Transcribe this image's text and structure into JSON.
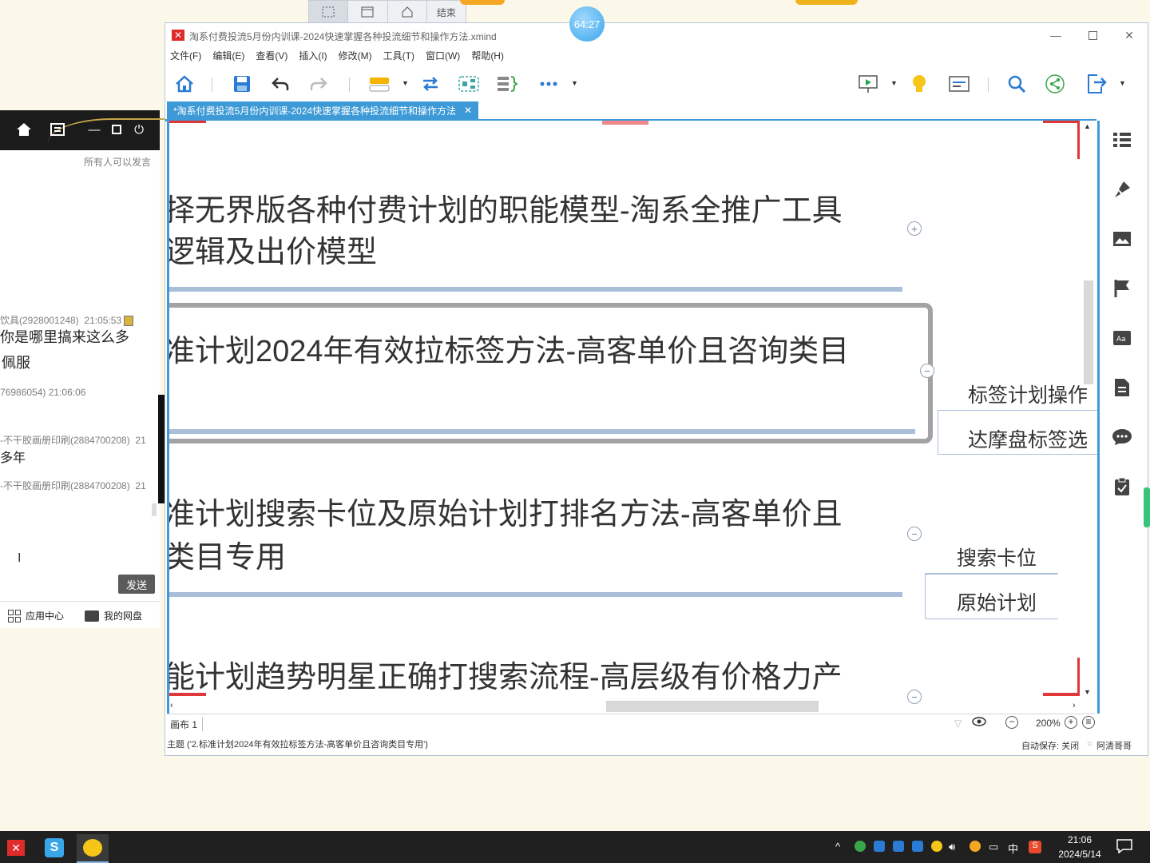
{
  "capture_bar": {
    "end_label": "结束"
  },
  "timer": "64:27",
  "chat": {
    "permission": "所有人可以发言",
    "messages": [
      {
        "sender": "饮具(2928001248)",
        "time": "21:05:53"
      },
      {
        "line1": "你是哪里搞来这么多",
        "line2": "佩服"
      },
      {
        "sender": "76986054)",
        "time": "21:06:06"
      },
      {
        "sender": "-不干胶画册印刷(2884700208)",
        "time": "21"
      },
      {
        "line1": "多年"
      },
      {
        "sender": "-不干胶画册印刷(2884700208)",
        "time": "21"
      }
    ],
    "send_label": "发送",
    "footer": {
      "app_center": "应用中心",
      "my_disk": "我的网盘"
    }
  },
  "window": {
    "title": "淘系付费投流5月份内训课-2024快速掌握各种投流细节和操作方法.xmind",
    "menu": [
      "文件(F)",
      "编辑(E)",
      "查看(V)",
      "插入(I)",
      "修改(M)",
      "工具(T)",
      "窗口(W)",
      "帮助(H)"
    ],
    "tab_label": "*淘系付费投流5月份内训课-2024快速掌握各种投流细节和操作方法",
    "topics": [
      {
        "line1": "择无界版各种付费计划的职能模型-淘系全推广工具",
        "line2": "逻辑及出价模型"
      },
      {
        "line1": "准计划2024年有效拉标签方法-高客单价且咨询类目"
      },
      {
        "line1": "准计划搜索卡位及原始计划打排名方法-高客单价且",
        "line2": "类目专用"
      },
      {
        "line1": "能计划趋势明星正确打搜索流程-高层级有价格力产"
      }
    ],
    "subtopics": {
      "t2": [
        "标签计划操作",
        "达摩盘标签选"
      ],
      "t3": [
        "搜索卡位",
        "原始计划"
      ]
    },
    "sheet": "画布 1",
    "zoom": "200%",
    "status_topic": "主题 ('2.标准计划2024年有效拉标签方法-高客单价且咨询类目专用')",
    "autosave": "自动保存: 关闭",
    "user": "阿清哥哥"
  },
  "taskbar": {
    "time": "21:06",
    "date": "2024/5/14",
    "ime": "中"
  }
}
